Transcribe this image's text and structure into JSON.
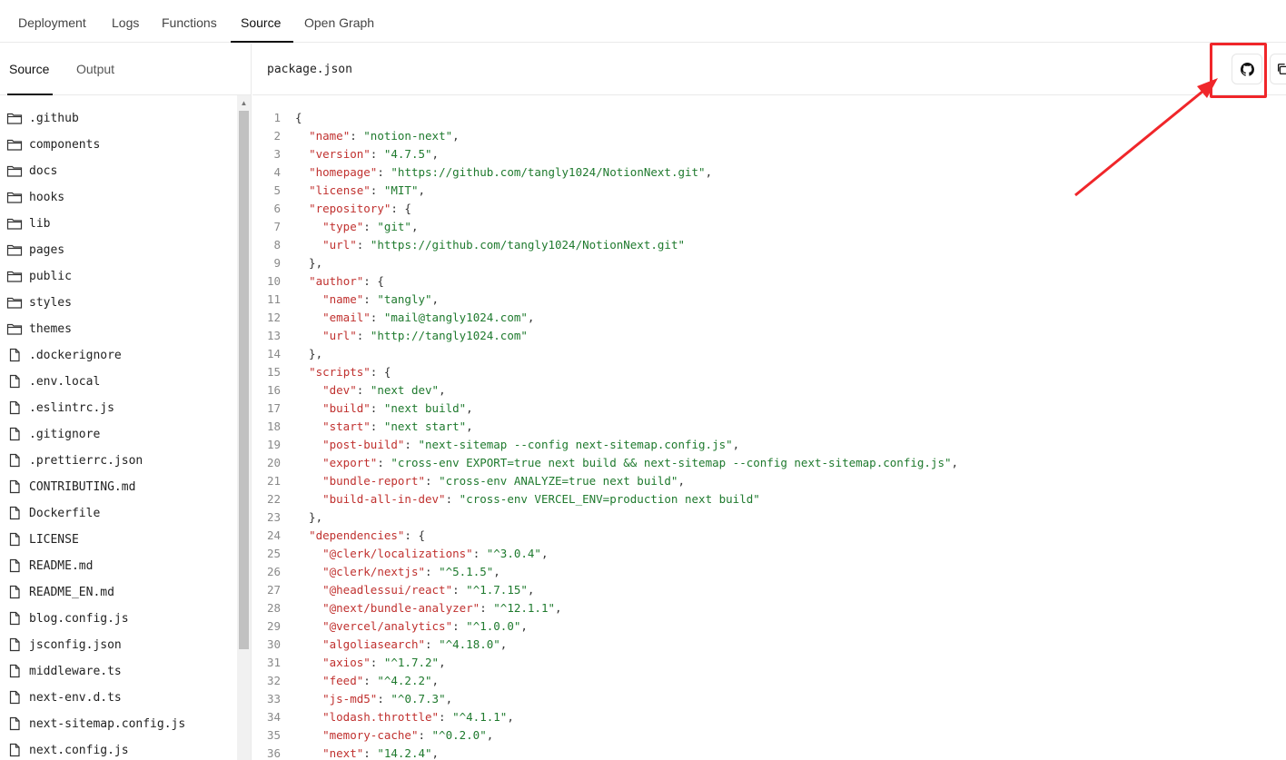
{
  "top_tabs": [
    {
      "label": "Deployment"
    },
    {
      "label": "Logs"
    },
    {
      "label": "Functions"
    },
    {
      "label": "Source"
    },
    {
      "label": "Open Graph"
    }
  ],
  "sidebar": {
    "tabs": [
      {
        "label": "Source"
      },
      {
        "label": "Output"
      }
    ],
    "items": [
      {
        "name": ".github",
        "type": "folder"
      },
      {
        "name": "components",
        "type": "folder"
      },
      {
        "name": "docs",
        "type": "folder"
      },
      {
        "name": "hooks",
        "type": "folder"
      },
      {
        "name": "lib",
        "type": "folder"
      },
      {
        "name": "pages",
        "type": "folder"
      },
      {
        "name": "public",
        "type": "folder"
      },
      {
        "name": "styles",
        "type": "folder"
      },
      {
        "name": "themes",
        "type": "folder"
      },
      {
        "name": ".dockerignore",
        "type": "file"
      },
      {
        "name": ".env.local",
        "type": "file"
      },
      {
        "name": ".eslintrc.js",
        "type": "file"
      },
      {
        "name": ".gitignore",
        "type": "file"
      },
      {
        "name": ".prettierrc.json",
        "type": "file"
      },
      {
        "name": "CONTRIBUTING.md",
        "type": "file"
      },
      {
        "name": "Dockerfile",
        "type": "file"
      },
      {
        "name": "LICENSE",
        "type": "file"
      },
      {
        "name": "README.md",
        "type": "file"
      },
      {
        "name": "README_EN.md",
        "type": "file"
      },
      {
        "name": "blog.config.js",
        "type": "file"
      },
      {
        "name": "jsconfig.json",
        "type": "file"
      },
      {
        "name": "middleware.ts",
        "type": "file"
      },
      {
        "name": "next-env.d.ts",
        "type": "file"
      },
      {
        "name": "next-sitemap.config.js",
        "type": "file"
      },
      {
        "name": "next.config.js",
        "type": "file"
      }
    ]
  },
  "editor": {
    "filename": "package.json",
    "github_button_icon": "github-icon",
    "copy_button_icon": "copy-icon",
    "lines": [
      [
        {
          "t": "p",
          "v": "{"
        }
      ],
      [
        {
          "t": "p",
          "v": "  "
        },
        {
          "t": "key",
          "v": "\"name\""
        },
        {
          "t": "p",
          "v": ": "
        },
        {
          "t": "str",
          "v": "\"notion-next\""
        },
        {
          "t": "p",
          "v": ","
        }
      ],
      [
        {
          "t": "p",
          "v": "  "
        },
        {
          "t": "key",
          "v": "\"version\""
        },
        {
          "t": "p",
          "v": ": "
        },
        {
          "t": "str",
          "v": "\"4.7.5\""
        },
        {
          "t": "p",
          "v": ","
        }
      ],
      [
        {
          "t": "p",
          "v": "  "
        },
        {
          "t": "key",
          "v": "\"homepage\""
        },
        {
          "t": "p",
          "v": ": "
        },
        {
          "t": "str",
          "v": "\"https://github.com/tangly1024/NotionNext.git\""
        },
        {
          "t": "p",
          "v": ","
        }
      ],
      [
        {
          "t": "p",
          "v": "  "
        },
        {
          "t": "key",
          "v": "\"license\""
        },
        {
          "t": "p",
          "v": ": "
        },
        {
          "t": "str",
          "v": "\"MIT\""
        },
        {
          "t": "p",
          "v": ","
        }
      ],
      [
        {
          "t": "p",
          "v": "  "
        },
        {
          "t": "key",
          "v": "\"repository\""
        },
        {
          "t": "p",
          "v": ": {"
        }
      ],
      [
        {
          "t": "p",
          "v": "    "
        },
        {
          "t": "key",
          "v": "\"type\""
        },
        {
          "t": "p",
          "v": ": "
        },
        {
          "t": "str",
          "v": "\"git\""
        },
        {
          "t": "p",
          "v": ","
        }
      ],
      [
        {
          "t": "p",
          "v": "    "
        },
        {
          "t": "key",
          "v": "\"url\""
        },
        {
          "t": "p",
          "v": ": "
        },
        {
          "t": "str",
          "v": "\"https://github.com/tangly1024/NotionNext.git\""
        }
      ],
      [
        {
          "t": "p",
          "v": "  },"
        }
      ],
      [
        {
          "t": "p",
          "v": "  "
        },
        {
          "t": "key",
          "v": "\"author\""
        },
        {
          "t": "p",
          "v": ": {"
        }
      ],
      [
        {
          "t": "p",
          "v": "    "
        },
        {
          "t": "key",
          "v": "\"name\""
        },
        {
          "t": "p",
          "v": ": "
        },
        {
          "t": "str",
          "v": "\"tangly\""
        },
        {
          "t": "p",
          "v": ","
        }
      ],
      [
        {
          "t": "p",
          "v": "    "
        },
        {
          "t": "key",
          "v": "\"email\""
        },
        {
          "t": "p",
          "v": ": "
        },
        {
          "t": "str",
          "v": "\"mail@tangly1024.com\""
        },
        {
          "t": "p",
          "v": ","
        }
      ],
      [
        {
          "t": "p",
          "v": "    "
        },
        {
          "t": "key",
          "v": "\"url\""
        },
        {
          "t": "p",
          "v": ": "
        },
        {
          "t": "str",
          "v": "\"http://tangly1024.com\""
        }
      ],
      [
        {
          "t": "p",
          "v": "  },"
        }
      ],
      [
        {
          "t": "p",
          "v": "  "
        },
        {
          "t": "key",
          "v": "\"scripts\""
        },
        {
          "t": "p",
          "v": ": {"
        }
      ],
      [
        {
          "t": "p",
          "v": "    "
        },
        {
          "t": "key",
          "v": "\"dev\""
        },
        {
          "t": "p",
          "v": ": "
        },
        {
          "t": "str",
          "v": "\"next dev\""
        },
        {
          "t": "p",
          "v": ","
        }
      ],
      [
        {
          "t": "p",
          "v": "    "
        },
        {
          "t": "key",
          "v": "\"build\""
        },
        {
          "t": "p",
          "v": ": "
        },
        {
          "t": "str",
          "v": "\"next build\""
        },
        {
          "t": "p",
          "v": ","
        }
      ],
      [
        {
          "t": "p",
          "v": "    "
        },
        {
          "t": "key",
          "v": "\"start\""
        },
        {
          "t": "p",
          "v": ": "
        },
        {
          "t": "str",
          "v": "\"next start\""
        },
        {
          "t": "p",
          "v": ","
        }
      ],
      [
        {
          "t": "p",
          "v": "    "
        },
        {
          "t": "key",
          "v": "\"post-build\""
        },
        {
          "t": "p",
          "v": ": "
        },
        {
          "t": "str",
          "v": "\"next-sitemap --config next-sitemap.config.js\""
        },
        {
          "t": "p",
          "v": ","
        }
      ],
      [
        {
          "t": "p",
          "v": "    "
        },
        {
          "t": "key",
          "v": "\"export\""
        },
        {
          "t": "p",
          "v": ": "
        },
        {
          "t": "str",
          "v": "\"cross-env EXPORT=true next build && next-sitemap --config next-sitemap.config.js\""
        },
        {
          "t": "p",
          "v": ","
        }
      ],
      [
        {
          "t": "p",
          "v": "    "
        },
        {
          "t": "key",
          "v": "\"bundle-report\""
        },
        {
          "t": "p",
          "v": ": "
        },
        {
          "t": "str",
          "v": "\"cross-env ANALYZE=true next build\""
        },
        {
          "t": "p",
          "v": ","
        }
      ],
      [
        {
          "t": "p",
          "v": "    "
        },
        {
          "t": "key",
          "v": "\"build-all-in-dev\""
        },
        {
          "t": "p",
          "v": ": "
        },
        {
          "t": "str",
          "v": "\"cross-env VERCEL_ENV=production next build\""
        }
      ],
      [
        {
          "t": "p",
          "v": "  },"
        }
      ],
      [
        {
          "t": "p",
          "v": "  "
        },
        {
          "t": "key",
          "v": "\"dependencies\""
        },
        {
          "t": "p",
          "v": ": {"
        }
      ],
      [
        {
          "t": "p",
          "v": "    "
        },
        {
          "t": "key",
          "v": "\"@clerk/localizations\""
        },
        {
          "t": "p",
          "v": ": "
        },
        {
          "t": "str",
          "v": "\"^3.0.4\""
        },
        {
          "t": "p",
          "v": ","
        }
      ],
      [
        {
          "t": "p",
          "v": "    "
        },
        {
          "t": "key",
          "v": "\"@clerk/nextjs\""
        },
        {
          "t": "p",
          "v": ": "
        },
        {
          "t": "str",
          "v": "\"^5.1.5\""
        },
        {
          "t": "p",
          "v": ","
        }
      ],
      [
        {
          "t": "p",
          "v": "    "
        },
        {
          "t": "key",
          "v": "\"@headlessui/react\""
        },
        {
          "t": "p",
          "v": ": "
        },
        {
          "t": "str",
          "v": "\"^1.7.15\""
        },
        {
          "t": "p",
          "v": ","
        }
      ],
      [
        {
          "t": "p",
          "v": "    "
        },
        {
          "t": "key",
          "v": "\"@next/bundle-analyzer\""
        },
        {
          "t": "p",
          "v": ": "
        },
        {
          "t": "str",
          "v": "\"^12.1.1\""
        },
        {
          "t": "p",
          "v": ","
        }
      ],
      [
        {
          "t": "p",
          "v": "    "
        },
        {
          "t": "key",
          "v": "\"@vercel/analytics\""
        },
        {
          "t": "p",
          "v": ": "
        },
        {
          "t": "str",
          "v": "\"^1.0.0\""
        },
        {
          "t": "p",
          "v": ","
        }
      ],
      [
        {
          "t": "p",
          "v": "    "
        },
        {
          "t": "key",
          "v": "\"algoliasearch\""
        },
        {
          "t": "p",
          "v": ": "
        },
        {
          "t": "str",
          "v": "\"^4.18.0\""
        },
        {
          "t": "p",
          "v": ","
        }
      ],
      [
        {
          "t": "p",
          "v": "    "
        },
        {
          "t": "key",
          "v": "\"axios\""
        },
        {
          "t": "p",
          "v": ": "
        },
        {
          "t": "str",
          "v": "\"^1.7.2\""
        },
        {
          "t": "p",
          "v": ","
        }
      ],
      [
        {
          "t": "p",
          "v": "    "
        },
        {
          "t": "key",
          "v": "\"feed\""
        },
        {
          "t": "p",
          "v": ": "
        },
        {
          "t": "str",
          "v": "\"^4.2.2\""
        },
        {
          "t": "p",
          "v": ","
        }
      ],
      [
        {
          "t": "p",
          "v": "    "
        },
        {
          "t": "key",
          "v": "\"js-md5\""
        },
        {
          "t": "p",
          "v": ": "
        },
        {
          "t": "str",
          "v": "\"^0.7.3\""
        },
        {
          "t": "p",
          "v": ","
        }
      ],
      [
        {
          "t": "p",
          "v": "    "
        },
        {
          "t": "key",
          "v": "\"lodash.throttle\""
        },
        {
          "t": "p",
          "v": ": "
        },
        {
          "t": "str",
          "v": "\"^4.1.1\""
        },
        {
          "t": "p",
          "v": ","
        }
      ],
      [
        {
          "t": "p",
          "v": "    "
        },
        {
          "t": "key",
          "v": "\"memory-cache\""
        },
        {
          "t": "p",
          "v": ": "
        },
        {
          "t": "str",
          "v": "\"^0.2.0\""
        },
        {
          "t": "p",
          "v": ","
        }
      ],
      [
        {
          "t": "p",
          "v": "    "
        },
        {
          "t": "key",
          "v": "\"next\""
        },
        {
          "t": "p",
          "v": ": "
        },
        {
          "t": "str",
          "v": "\"14.2.4\""
        },
        {
          "t": "p",
          "v": ","
        }
      ]
    ]
  },
  "colors": {
    "json_key": "#c0312f",
    "json_string": "#1f7a2e",
    "annotation_red": "#f0262a"
  }
}
